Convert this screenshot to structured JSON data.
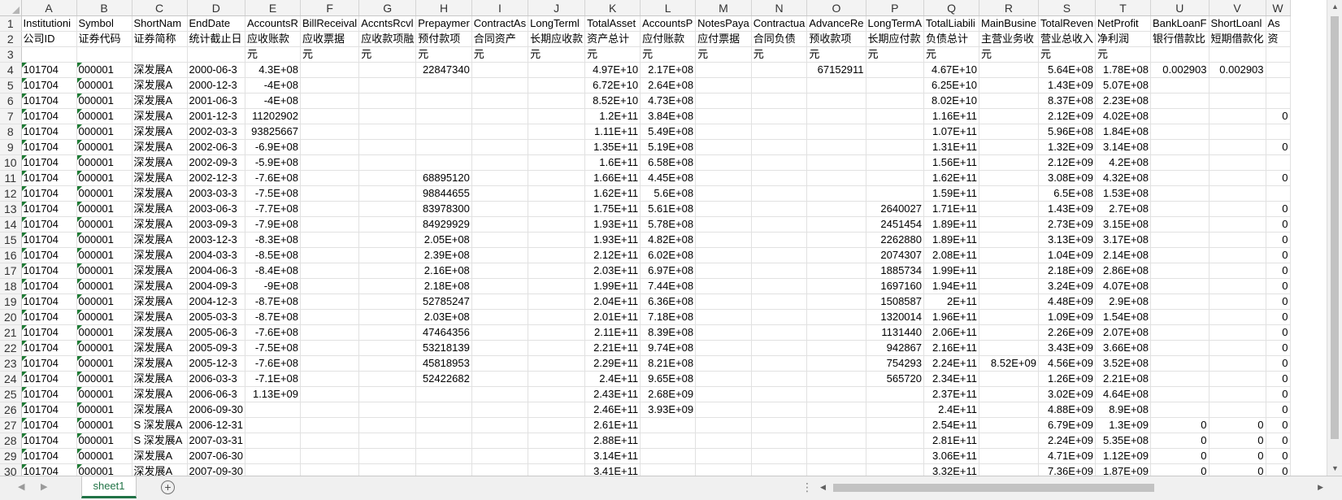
{
  "columns": [
    "A",
    "B",
    "C",
    "D",
    "E",
    "F",
    "G",
    "H",
    "I",
    "J",
    "K",
    "L",
    "M",
    "N",
    "O",
    "P",
    "Q",
    "R",
    "S",
    "T",
    "U",
    "V",
    "W"
  ],
  "row1": [
    "Institutioni",
    "Symbol",
    "ShortNam",
    "EndDate",
    "AccountsR",
    "BillReceival",
    "AccntsRcvl",
    "Prepaymer",
    "ContractAs",
    "LongTerml",
    "TotalAsset",
    "AccountsP",
    "NotesPaya",
    "Contractua",
    "AdvanceRe",
    "LongTermA",
    "TotalLiabili",
    "MainBusine",
    "TotalReven",
    "NetProfit",
    "BankLoanF",
    "ShortLoanl",
    "As"
  ],
  "row2": [
    "公司ID",
    "证券代码",
    "证券简称",
    "统计截止日",
    "应收账款",
    "应收票据",
    "应收款项融",
    "预付款项",
    "合同资产",
    "长期应收款",
    "资产总计",
    "应付账款",
    "应付票据",
    "合同负债",
    "预收款项",
    "长期应付款",
    "负债总计",
    "主营业务收",
    "营业总收入",
    "净利润",
    "银行借款比",
    "短期借款化",
    "资"
  ],
  "row3": [
    "",
    "",
    "",
    "",
    "元",
    "元",
    "元",
    "元",
    "元",
    "元",
    "元",
    "元",
    "元",
    "元",
    "元",
    "元",
    "元",
    "元",
    "元",
    "元",
    "",
    "",
    ""
  ],
  "data_rows": [
    {
      "num": "4",
      "c": [
        "101704",
        "000001",
        "深发展A",
        "2000-06-3",
        "4.3E+08",
        "",
        "",
        "22847340",
        "",
        "",
        "4.97E+10",
        "2.17E+08",
        "",
        "",
        "67152911",
        "",
        "4.67E+10",
        "",
        "5.64E+08",
        "1.78E+08",
        "0.002903",
        "0.002903",
        ""
      ]
    },
    {
      "num": "5",
      "c": [
        "101704",
        "000001",
        "深发展A",
        "2000-12-3",
        "-4E+08",
        "",
        "",
        "",
        "",
        "",
        "6.72E+10",
        "2.64E+08",
        "",
        "",
        "",
        "",
        "6.25E+10",
        "",
        "1.43E+09",
        "5.07E+08",
        "",
        "",
        ""
      ]
    },
    {
      "num": "6",
      "c": [
        "101704",
        "000001",
        "深发展A",
        "2001-06-3",
        "-4E+08",
        "",
        "",
        "",
        "",
        "",
        "8.52E+10",
        "4.73E+08",
        "",
        "",
        "",
        "",
        "8.02E+10",
        "",
        "8.37E+08",
        "2.23E+08",
        "",
        "",
        ""
      ]
    },
    {
      "num": "7",
      "c": [
        "101704",
        "000001",
        "深发展A",
        "2001-12-3",
        "11202902",
        "",
        "",
        "",
        "",
        "",
        "1.2E+11",
        "3.84E+08",
        "",
        "",
        "",
        "",
        "1.16E+11",
        "",
        "2.12E+09",
        "4.02E+08",
        "",
        "",
        "0"
      ]
    },
    {
      "num": "8",
      "c": [
        "101704",
        "000001",
        "深发展A",
        "2002-03-3",
        "93825667",
        "",
        "",
        "",
        "",
        "",
        "1.11E+11",
        "5.49E+08",
        "",
        "",
        "",
        "",
        "1.07E+11",
        "",
        "5.96E+08",
        "1.84E+08",
        "",
        "",
        ""
      ]
    },
    {
      "num": "9",
      "c": [
        "101704",
        "000001",
        "深发展A",
        "2002-06-3",
        "-6.9E+08",
        "",
        "",
        "",
        "",
        "",
        "1.35E+11",
        "5.19E+08",
        "",
        "",
        "",
        "",
        "1.31E+11",
        "",
        "1.32E+09",
        "3.14E+08",
        "",
        "",
        "0"
      ]
    },
    {
      "num": "10",
      "c": [
        "101704",
        "000001",
        "深发展A",
        "2002-09-3",
        "-5.9E+08",
        "",
        "",
        "",
        "",
        "",
        "1.6E+11",
        "6.58E+08",
        "",
        "",
        "",
        "",
        "1.56E+11",
        "",
        "2.12E+09",
        "4.2E+08",
        "",
        "",
        ""
      ]
    },
    {
      "num": "11",
      "c": [
        "101704",
        "000001",
        "深发展A",
        "2002-12-3",
        "-7.6E+08",
        "",
        "",
        "68895120",
        "",
        "",
        "1.66E+11",
        "4.45E+08",
        "",
        "",
        "",
        "",
        "1.62E+11",
        "",
        "3.08E+09",
        "4.32E+08",
        "",
        "",
        "0"
      ]
    },
    {
      "num": "12",
      "c": [
        "101704",
        "000001",
        "深发展A",
        "2003-03-3",
        "-7.5E+08",
        "",
        "",
        "98844655",
        "",
        "",
        "1.62E+11",
        "5.6E+08",
        "",
        "",
        "",
        "",
        "1.59E+11",
        "",
        "6.5E+08",
        "1.53E+08",
        "",
        "",
        ""
      ]
    },
    {
      "num": "13",
      "c": [
        "101704",
        "000001",
        "深发展A",
        "2003-06-3",
        "-7.7E+08",
        "",
        "",
        "83978300",
        "",
        "",
        "1.75E+11",
        "5.61E+08",
        "",
        "",
        "",
        "2640027",
        "1.71E+11",
        "",
        "1.43E+09",
        "2.7E+08",
        "",
        "",
        "0"
      ]
    },
    {
      "num": "14",
      "c": [
        "101704",
        "000001",
        "深发展A",
        "2003-09-3",
        "-7.9E+08",
        "",
        "",
        "84929929",
        "",
        "",
        "1.93E+11",
        "5.78E+08",
        "",
        "",
        "",
        "2451454",
        "1.89E+11",
        "",
        "2.73E+09",
        "3.15E+08",
        "",
        "",
        "0"
      ]
    },
    {
      "num": "15",
      "c": [
        "101704",
        "000001",
        "深发展A",
        "2003-12-3",
        "-8.3E+08",
        "",
        "",
        "2.05E+08",
        "",
        "",
        "1.93E+11",
        "4.82E+08",
        "",
        "",
        "",
        "2262880",
        "1.89E+11",
        "",
        "3.13E+09",
        "3.17E+08",
        "",
        "",
        "0"
      ]
    },
    {
      "num": "16",
      "c": [
        "101704",
        "000001",
        "深发展A",
        "2004-03-3",
        "-8.5E+08",
        "",
        "",
        "2.39E+08",
        "",
        "",
        "2.12E+11",
        "6.02E+08",
        "",
        "",
        "",
        "2074307",
        "2.08E+11",
        "",
        "1.04E+09",
        "2.14E+08",
        "",
        "",
        "0"
      ]
    },
    {
      "num": "17",
      "c": [
        "101704",
        "000001",
        "深发展A",
        "2004-06-3",
        "-8.4E+08",
        "",
        "",
        "2.16E+08",
        "",
        "",
        "2.03E+11",
        "6.97E+08",
        "",
        "",
        "",
        "1885734",
        "1.99E+11",
        "",
        "2.18E+09",
        "2.86E+08",
        "",
        "",
        "0"
      ]
    },
    {
      "num": "18",
      "c": [
        "101704",
        "000001",
        "深发展A",
        "2004-09-3",
        "-9E+08",
        "",
        "",
        "2.18E+08",
        "",
        "",
        "1.99E+11",
        "7.44E+08",
        "",
        "",
        "",
        "1697160",
        "1.94E+11",
        "",
        "3.24E+09",
        "4.07E+08",
        "",
        "",
        "0"
      ]
    },
    {
      "num": "19",
      "c": [
        "101704",
        "000001",
        "深发展A",
        "2004-12-3",
        "-8.7E+08",
        "",
        "",
        "52785247",
        "",
        "",
        "2.04E+11",
        "6.36E+08",
        "",
        "",
        "",
        "1508587",
        "2E+11",
        "",
        "4.48E+09",
        "2.9E+08",
        "",
        "",
        "0"
      ]
    },
    {
      "num": "20",
      "c": [
        "101704",
        "000001",
        "深发展A",
        "2005-03-3",
        "-8.7E+08",
        "",
        "",
        "2.03E+08",
        "",
        "",
        "2.01E+11",
        "7.18E+08",
        "",
        "",
        "",
        "1320014",
        "1.96E+11",
        "",
        "1.09E+09",
        "1.54E+08",
        "",
        "",
        "0"
      ]
    },
    {
      "num": "21",
      "c": [
        "101704",
        "000001",
        "深发展A",
        "2005-06-3",
        "-7.6E+08",
        "",
        "",
        "47464356",
        "",
        "",
        "2.11E+11",
        "8.39E+08",
        "",
        "",
        "",
        "1131440",
        "2.06E+11",
        "",
        "2.26E+09",
        "2.07E+08",
        "",
        "",
        "0"
      ]
    },
    {
      "num": "22",
      "c": [
        "101704",
        "000001",
        "深发展A",
        "2005-09-3",
        "-7.5E+08",
        "",
        "",
        "53218139",
        "",
        "",
        "2.21E+11",
        "9.74E+08",
        "",
        "",
        "",
        "942867",
        "2.16E+11",
        "",
        "3.43E+09",
        "3.66E+08",
        "",
        "",
        "0"
      ]
    },
    {
      "num": "23",
      "c": [
        "101704",
        "000001",
        "深发展A",
        "2005-12-3",
        "-7.6E+08",
        "",
        "",
        "45818953",
        "",
        "",
        "2.29E+11",
        "8.21E+08",
        "",
        "",
        "",
        "754293",
        "2.24E+11",
        "8.52E+09",
        "4.56E+09",
        "3.52E+08",
        "",
        "",
        "0"
      ]
    },
    {
      "num": "24",
      "c": [
        "101704",
        "000001",
        "深发展A",
        "2006-03-3",
        "-7.1E+08",
        "",
        "",
        "52422682",
        "",
        "",
        "2.4E+11",
        "9.65E+08",
        "",
        "",
        "",
        "565720",
        "2.34E+11",
        "",
        "1.26E+09",
        "2.21E+08",
        "",
        "",
        "0"
      ]
    },
    {
      "num": "25",
      "c": [
        "101704",
        "000001",
        "深发展A",
        "2006-06-3",
        "1.13E+09",
        "",
        "",
        "",
        "",
        "",
        "2.43E+11",
        "2.68E+09",
        "",
        "",
        "",
        "",
        "2.37E+11",
        "",
        "3.02E+09",
        "4.64E+08",
        "",
        "",
        "0"
      ]
    },
    {
      "num": "26",
      "c": [
        "101704",
        "000001",
        "深发展A",
        "2006-09-30",
        "",
        "",
        "",
        "",
        "",
        "",
        "2.46E+11",
        "3.93E+09",
        "",
        "",
        "",
        "",
        "2.4E+11",
        "",
        "4.88E+09",
        "8.9E+08",
        "",
        "",
        "0"
      ]
    },
    {
      "num": "27",
      "c": [
        "101704",
        "000001",
        "S 深发展A",
        "2006-12-31",
        "",
        "",
        "",
        "",
        "",
        "",
        "2.61E+11",
        "",
        "",
        "",
        "",
        "",
        "2.54E+11",
        "",
        "6.79E+09",
        "1.3E+09",
        "0",
        "0",
        "0"
      ]
    },
    {
      "num": "28",
      "c": [
        "101704",
        "000001",
        "S 深发展A",
        "2007-03-31",
        "",
        "",
        "",
        "",
        "",
        "",
        "2.88E+11",
        "",
        "",
        "",
        "",
        "",
        "2.81E+11",
        "",
        "2.24E+09",
        "5.35E+08",
        "0",
        "0",
        "0"
      ]
    },
    {
      "num": "29",
      "c": [
        "101704",
        "000001",
        "深发展A",
        "2007-06-30",
        "",
        "",
        "",
        "",
        "",
        "",
        "3.14E+11",
        "",
        "",
        "",
        "",
        "",
        "3.06E+11",
        "",
        "4.71E+09",
        "1.12E+09",
        "0",
        "0",
        "0"
      ]
    },
    {
      "num": "30",
      "c": [
        "101704",
        "000001",
        "深发展A",
        "2007-09-30",
        "",
        "",
        "",
        "",
        "",
        "",
        "3.41E+11",
        "",
        "",
        "",
        "",
        "",
        "3.32E+11",
        "",
        "7.36E+09",
        "1.87E+09",
        "0",
        "0",
        "0"
      ]
    }
  ],
  "sheet_tab": "sheet1",
  "add_sheet_symbol": "+",
  "nav_prev": "◀",
  "nav_next": "▶",
  "scroll_up": "▲",
  "scroll_down": "▼",
  "scroll_left": "◀",
  "scroll_right": "▶",
  "dots": "⋮"
}
